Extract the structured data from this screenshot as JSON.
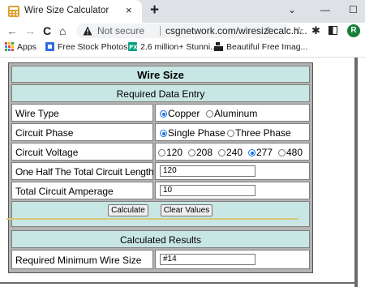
{
  "browser": {
    "tab_title": "Wire Size Calculator",
    "tab_close": "×",
    "new_tab": "+",
    "window_controls": {
      "dropdown": "⌄",
      "minimize": "—",
      "maximize": "☐"
    },
    "nav": {
      "back": "←",
      "forward": "→",
      "reload": "C",
      "home": "⌂"
    },
    "security_label": "Not secure",
    "url": "csgnetwork.com/wiresizecalc.h...",
    "toolbar_icons": [
      "share-icon",
      "star-icon",
      "extensions-icon",
      "sidebar-icon",
      "profile-icon"
    ],
    "profile_initial": "R",
    "bookmarks": [
      {
        "label": "Apps",
        "icon": "apps-grid-icon"
      },
      {
        "label": "Free Stock Photos,...",
        "icon": "photos-icon"
      },
      {
        "label": "2.6 million+ Stunni...",
        "icon": "px-icon"
      },
      {
        "label": "Beautiful Free Imag...",
        "icon": "camera-icon"
      }
    ],
    "colors": {
      "tabbar": "#dee1e6",
      "avatar": "#188038",
      "accent": "#1a73e8"
    }
  },
  "form": {
    "title": "Wire Size",
    "section_required": "Required Data Entry",
    "wire_type": {
      "label": "Wire Type",
      "options": [
        "Copper",
        "Aluminum"
      ],
      "selected": "Copper"
    },
    "circuit_phase": {
      "label": "Circuit Phase",
      "options": [
        "Single Phase",
        "Three Phase"
      ],
      "selected": "Single Phase"
    },
    "circuit_voltage": {
      "label": "Circuit Voltage",
      "options": [
        "120",
        "208",
        "240",
        "277",
        "480"
      ],
      "selected": "277"
    },
    "half_length": {
      "label": "One Half The Total Circuit Length",
      "value": "120"
    },
    "amperage": {
      "label": "Total Circuit Amperage",
      "value": "10"
    },
    "buttons": {
      "calculate": "Calculate",
      "clear": "Clear Values"
    },
    "section_results": "Calculated Results",
    "min_wire": {
      "label": "Required Minimum Wire Size",
      "value": "#14"
    },
    "colors": {
      "header_teal": "#c8e6e3",
      "frame": "#b3b3b3",
      "divider": "#d8c97a"
    }
  }
}
